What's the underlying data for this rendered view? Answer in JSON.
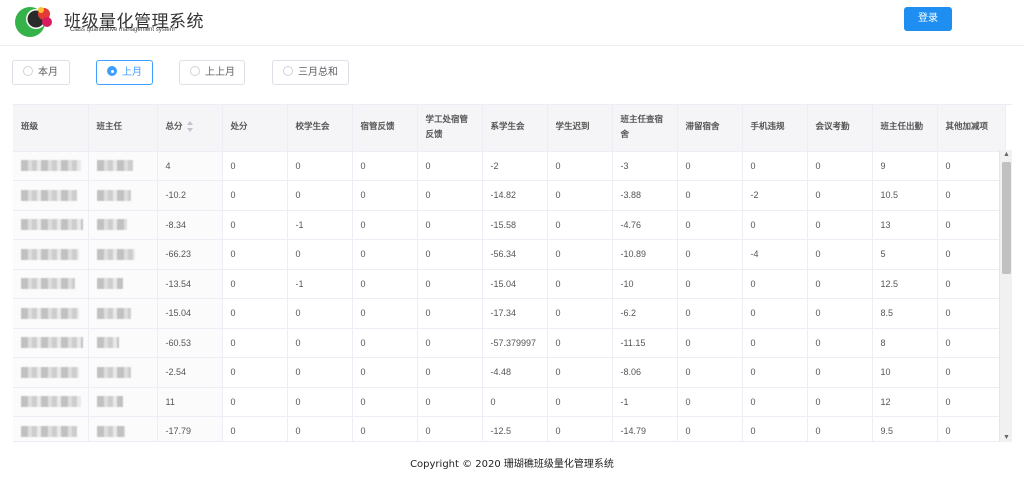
{
  "header": {
    "title": "班级量化管理系统",
    "subtitle": "Class quantitative management system",
    "login_label": "登录"
  },
  "period_options": [
    {
      "label": "本月",
      "selected": false
    },
    {
      "label": "上月",
      "selected": true
    },
    {
      "label": "上上月",
      "selected": false
    },
    {
      "label": "三月总和",
      "selected": false
    }
  ],
  "table": {
    "columns": [
      "班级",
      "班主任",
      "总分",
      "处分",
      "校学生会",
      "宿管反馈",
      "学工处宿管反馈",
      "系学生会",
      "学生迟到",
      "班主任查宿舍",
      "滞留宿舍",
      "手机违规",
      "会议考勤",
      "班主任出勤",
      "其他加减项"
    ],
    "rows": [
      [
        "4",
        "0",
        "0",
        "0",
        "0",
        "-2",
        "0",
        "-3",
        "0",
        "0",
        "0",
        "9",
        "0"
      ],
      [
        "-10.2",
        "0",
        "0",
        "0",
        "0",
        "-14.82",
        "0",
        "-3.88",
        "0",
        "-2",
        "0",
        "10.5",
        "0"
      ],
      [
        "-8.34",
        "0",
        "-1",
        "0",
        "0",
        "-15.58",
        "0",
        "-4.76",
        "0",
        "0",
        "0",
        "13",
        "0"
      ],
      [
        "-66.23",
        "0",
        "0",
        "0",
        "0",
        "-56.34",
        "0",
        "-10.89",
        "0",
        "-4",
        "0",
        "5",
        "0"
      ],
      [
        "-13.54",
        "0",
        "-1",
        "0",
        "0",
        "-15.04",
        "0",
        "-10",
        "0",
        "0",
        "0",
        "12.5",
        "0"
      ],
      [
        "-15.04",
        "0",
        "0",
        "0",
        "0",
        "-17.34",
        "0",
        "-6.2",
        "0",
        "0",
        "0",
        "8.5",
        "0"
      ],
      [
        "-60.53",
        "0",
        "0",
        "0",
        "0",
        "-57.379997",
        "0",
        "-11.15",
        "0",
        "0",
        "0",
        "8",
        "0"
      ],
      [
        "-2.54",
        "0",
        "0",
        "0",
        "0",
        "-4.48",
        "0",
        "-8.06",
        "0",
        "0",
        "0",
        "10",
        "0"
      ],
      [
        "11",
        "0",
        "0",
        "0",
        "0",
        "0",
        "0",
        "-1",
        "0",
        "0",
        "0",
        "12",
        "0"
      ],
      [
        "-17.79",
        "0",
        "0",
        "0",
        "0",
        "-12.5",
        "0",
        "-14.79",
        "0",
        "0",
        "0",
        "9.5",
        "0"
      ]
    ]
  },
  "footer": {
    "copyright": "Copyright © 2020 珊瑚礁班级量化管理系统"
  },
  "icons": {
    "logo": "colorful-circle-logo-icon",
    "sort": "sort-caret-icon",
    "scroll_up": "scroll-up-icon",
    "scroll_down": "scroll-down-icon"
  },
  "colors": {
    "primary": "#1f8ef1",
    "radio_active": "#409eff",
    "header_bg": "#f5f5f7"
  }
}
